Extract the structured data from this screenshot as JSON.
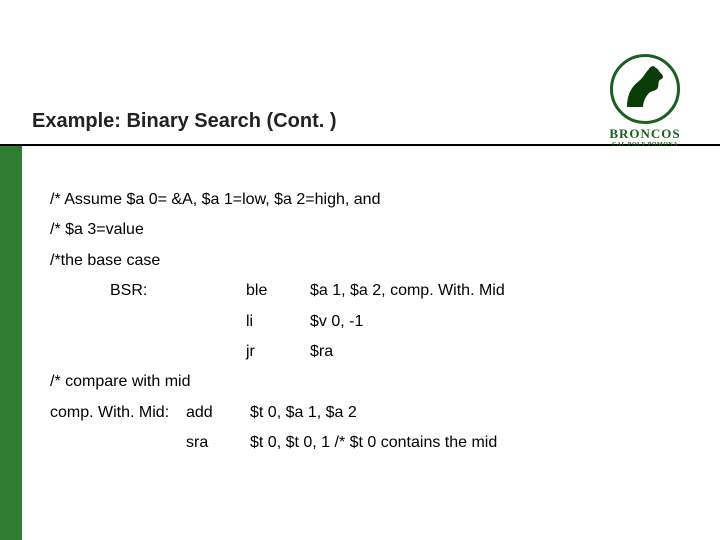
{
  "title": "Example: Binary Search (Cont. )",
  "logo": {
    "line1": "BRONCOS",
    "line2": "CAL POLY POMONA"
  },
  "code": {
    "l1": "/* Assume $a 0= &A, $a 1=low, $a 2=high, and",
    "l2": "/* $a 3=value",
    "l3": "/*the base case",
    "row1": {
      "label": "BSR:",
      "op": "ble",
      "args": "$a 1, $a 2, comp. With. Mid"
    },
    "row2": {
      "label": "",
      "op": "li",
      "args": "$v 0, -1"
    },
    "row3": {
      "label": "",
      "op": "jr",
      "args": "$ra"
    },
    "l4": "/* compare with mid",
    "row4": {
      "label": "comp. With. Mid:",
      "op": "add",
      "args": "$t 0, $a 1, $a 2"
    },
    "row5": {
      "label": "",
      "op": "sra",
      "args": "$t 0, $t 0, 1   /* $t 0 contains the mid"
    }
  }
}
